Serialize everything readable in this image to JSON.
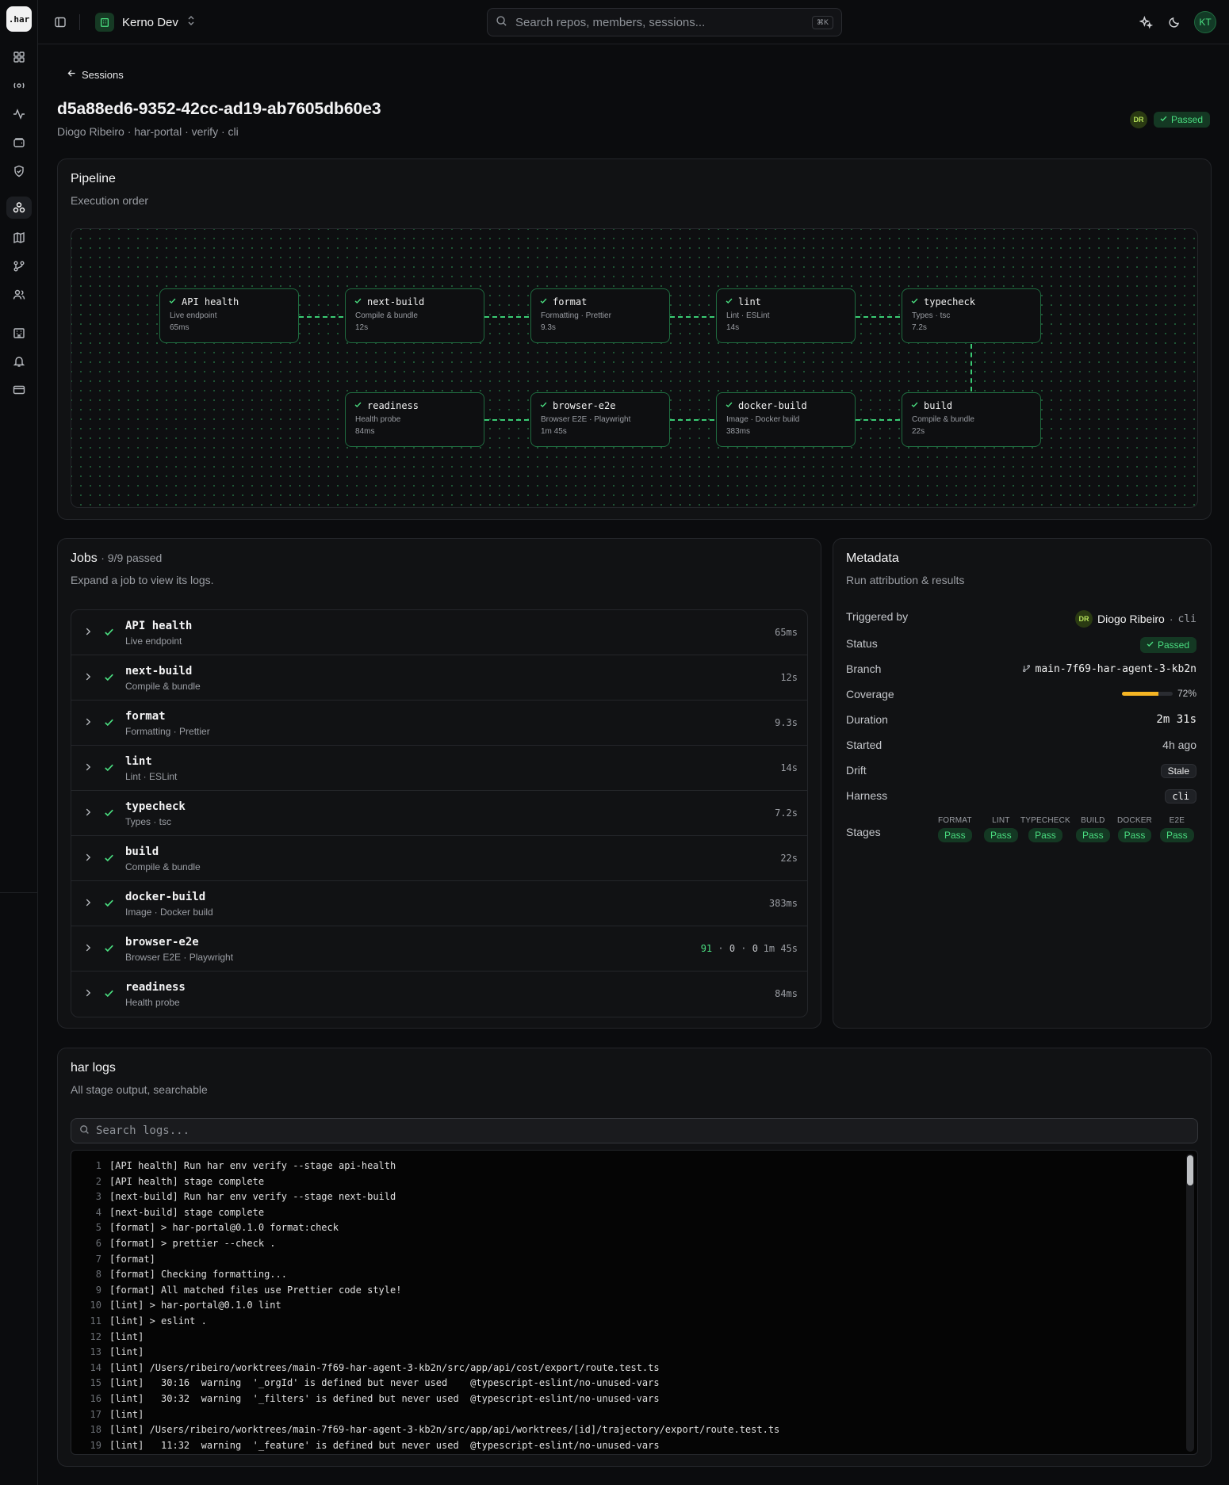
{
  "app": {
    "logo": ".har",
    "workspace": "Kerno Dev",
    "user_initials": "KT"
  },
  "search": {
    "placeholder": "Search repos, members, sessions...",
    "shortcut": "⌘K"
  },
  "header": {
    "back_label": "Sessions",
    "title": "d5a88ed6-9352-42cc-ad19-ab7605db60e3",
    "subtitle": "Diogo Ribeiro · har-portal · verify · cli",
    "avatar": "DR",
    "status": "Passed"
  },
  "pipeline": {
    "title": "Pipeline",
    "description": "Execution order",
    "nodes": [
      {
        "name": "API health",
        "desc": "Live endpoint",
        "duration": "65ms"
      },
      {
        "name": "next-build",
        "desc": "Compile & bundle",
        "duration": "12s"
      },
      {
        "name": "format",
        "desc": "Formatting · Prettier",
        "duration": "9.3s"
      },
      {
        "name": "lint",
        "desc": "Lint · ESLint",
        "duration": "14s"
      },
      {
        "name": "typecheck",
        "desc": "Types · tsc",
        "duration": "7.2s"
      },
      {
        "name": "readiness",
        "desc": "Health probe",
        "duration": "84ms"
      },
      {
        "name": "browser-e2e",
        "desc": "Browser E2E · Playwright",
        "duration": "1m 45s"
      },
      {
        "name": "docker-build",
        "desc": "Image · Docker build",
        "duration": "383ms"
      },
      {
        "name": "build",
        "desc": "Compile & bundle",
        "duration": "22s"
      }
    ]
  },
  "jobs": {
    "title": "Jobs",
    "summary": "· 9/9 passed",
    "description": "Expand a job to view its logs.",
    "items": [
      {
        "name": "API health",
        "desc": "Live endpoint",
        "duration": "65ms"
      },
      {
        "name": "next-build",
        "desc": "Compile & bundle",
        "duration": "12s"
      },
      {
        "name": "format",
        "desc": "Formatting · Prettier",
        "duration": "9.3s"
      },
      {
        "name": "lint",
        "desc": "Lint · ESLint",
        "duration": "14s"
      },
      {
        "name": "typecheck",
        "desc": "Types · tsc",
        "duration": "7.2s"
      },
      {
        "name": "build",
        "desc": "Compile & bundle",
        "duration": "22s"
      },
      {
        "name": "docker-build",
        "desc": "Image · Docker build",
        "duration": "383ms"
      },
      {
        "name": "browser-e2e",
        "desc": "Browser E2E · Playwright",
        "duration": "1m 45s",
        "passed": "91",
        "failed": "0",
        "skipped": "0"
      },
      {
        "name": "readiness",
        "desc": "Health probe",
        "duration": "84ms"
      }
    ]
  },
  "metadata": {
    "title": "Metadata",
    "description": "Run attribution & results",
    "triggered_by_label": "Triggered by",
    "triggered_by_initials": "DR",
    "triggered_by_name": "Diogo Ribeiro",
    "triggered_by_sep": "·",
    "triggered_by_via": "cli",
    "status_label": "Status",
    "status_value": "Passed",
    "branch_label": "Branch",
    "branch_value": "main-7f69-har-agent-3-kb2n",
    "coverage_label": "Coverage",
    "coverage_value": "72%",
    "coverage_fraction": 0.72,
    "duration_label": "Duration",
    "duration_value": "2m 31s",
    "started_label": "Started",
    "started_value": "4h ago",
    "drift_label": "Drift",
    "drift_value": "Stale",
    "harness_label": "Harness",
    "harness_value": "cli",
    "stages_label": "Stages",
    "stages": [
      {
        "name": "FORMAT",
        "result": "Pass"
      },
      {
        "name": "LINT",
        "result": "Pass"
      },
      {
        "name": "TYPECHECK",
        "result": "Pass"
      },
      {
        "name": "BUILD",
        "result": "Pass"
      },
      {
        "name": "DOCKER",
        "result": "Pass"
      },
      {
        "name": "E2E",
        "result": "Pass"
      }
    ]
  },
  "logs": {
    "title": "har logs",
    "description": "All stage output, searchable",
    "search_placeholder": "Search logs...",
    "lines": [
      "[API health] Run har env verify --stage api-health",
      "[API health] stage complete",
      "[next-build] Run har env verify --stage next-build",
      "[next-build] stage complete",
      "[format] > har-portal@0.1.0 format:check",
      "[format] > prettier --check .",
      "[format]",
      "[format] Checking formatting...",
      "[format] All matched files use Prettier code style!",
      "[lint] > har-portal@0.1.0 lint",
      "[lint] > eslint .",
      "[lint]",
      "[lint]",
      "[lint] /Users/ribeiro/worktrees/main-7f69-har-agent-3-kb2n/src/app/api/cost/export/route.test.ts",
      "[lint]   30:16  warning  '_orgId' is defined but never used    @typescript-eslint/no-unused-vars",
      "[lint]   30:32  warning  '_filters' is defined but never used  @typescript-eslint/no-unused-vars",
      "[lint]",
      "[lint] /Users/ribeiro/worktrees/main-7f69-har-agent-3-kb2n/src/app/api/worktrees/[id]/trajectory/export/route.test.ts",
      "[lint]   11:32  warning  '_feature' is defined but never used  @typescript-eslint/no-unused-vars"
    ]
  },
  "colors": {
    "accent": "#4ade80",
    "warning": "#f5b524",
    "background": "#0b0c0e",
    "card": "#111214"
  }
}
